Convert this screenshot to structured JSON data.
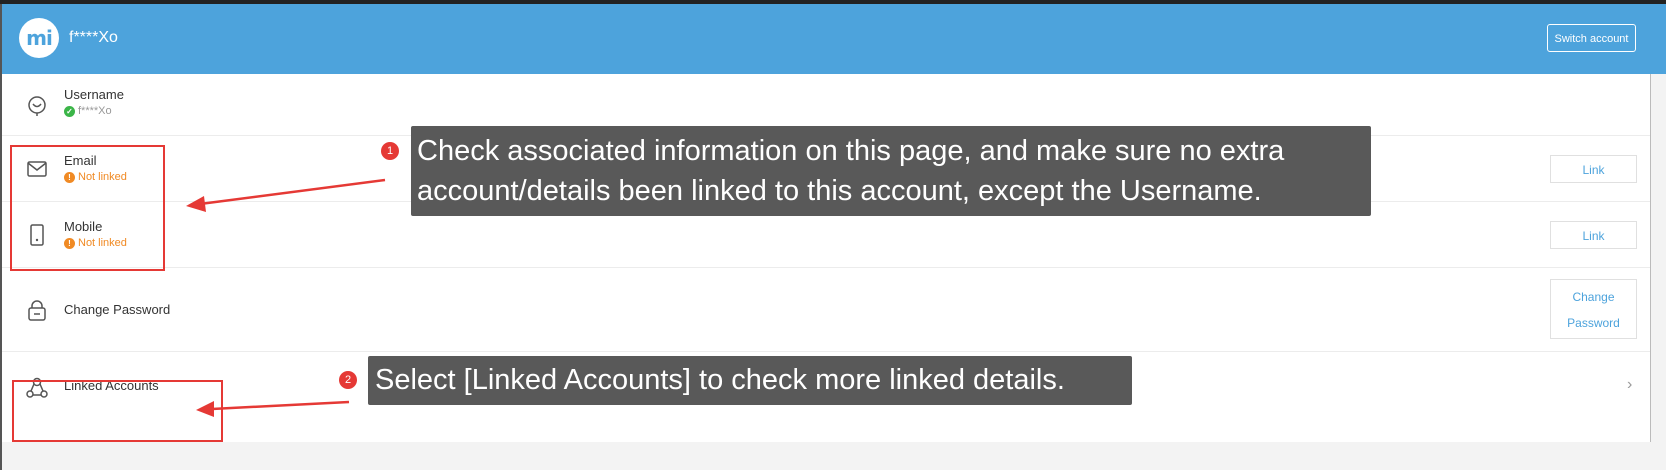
{
  "header": {
    "logo_text": "mi",
    "username": "f****Xo",
    "switch_label": "Switch account"
  },
  "rows": {
    "username": {
      "label": "Username",
      "value": "f****Xo",
      "status_icon": "check"
    },
    "email": {
      "label": "Email",
      "status": "Not linked",
      "status_icon": "!",
      "button": "Link"
    },
    "mobile": {
      "label": "Mobile",
      "status": "Not linked",
      "status_icon": "!",
      "button": "Link"
    },
    "password": {
      "label": "Change Password",
      "button_line1": "Change",
      "button_line2": "Password"
    },
    "linked": {
      "label": "Linked Accounts",
      "chevron": "›"
    }
  },
  "annotations": {
    "a1": {
      "number": "1",
      "line1": "Check associated information on this page, and make sure no extra",
      "line2": "account/details been linked to this account, except the Username."
    },
    "a2": {
      "number": "2",
      "text": "Select [Linked Accounts] to check more linked details."
    }
  },
  "colors": {
    "header": "#4da3dc",
    "highlight": "#e53935",
    "callout": "#595959",
    "warning": "#f08a24",
    "ok": "#3bb548"
  }
}
